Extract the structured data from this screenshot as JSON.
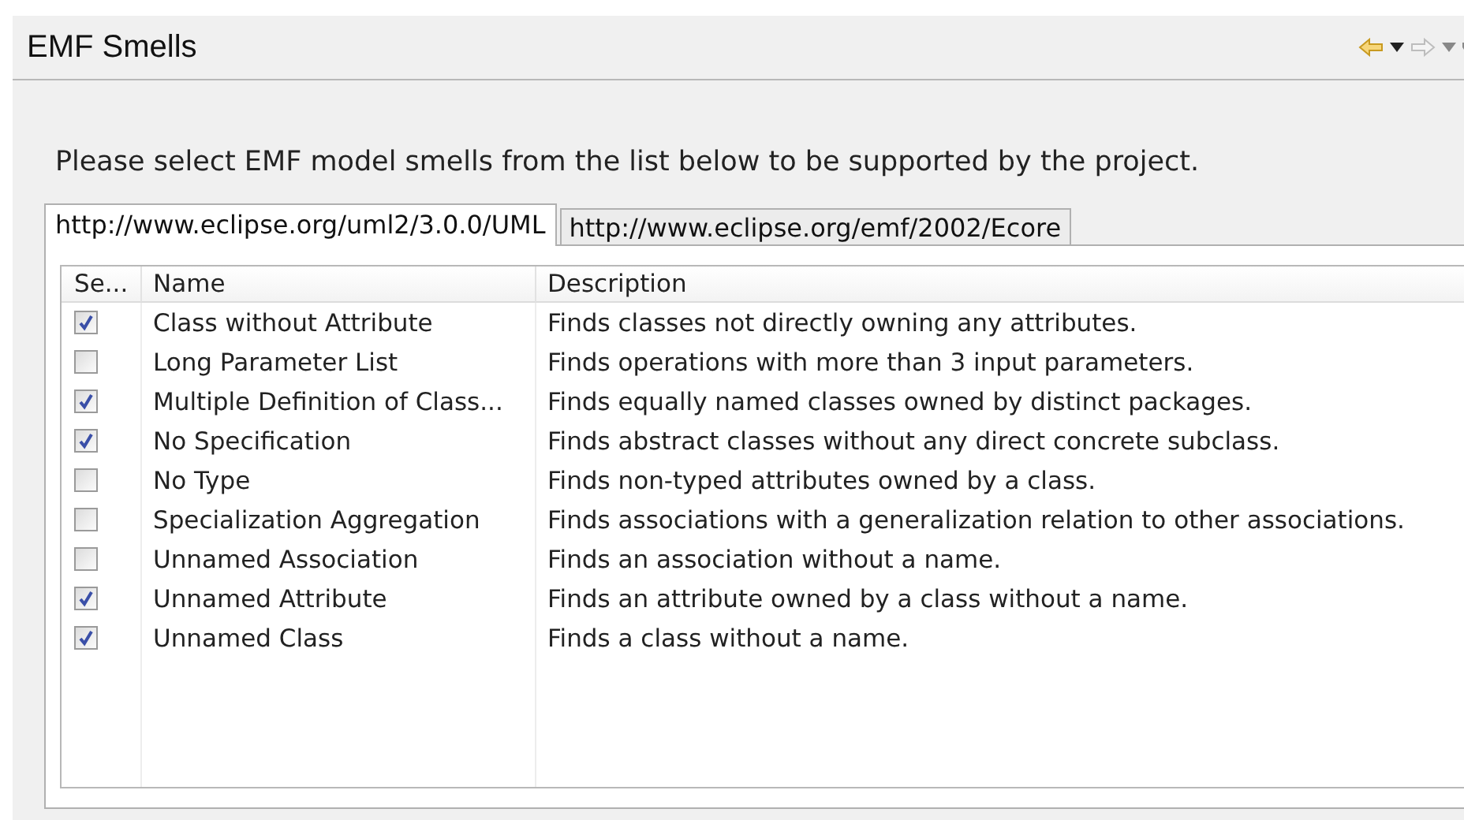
{
  "view": {
    "title": "EMF Smells",
    "back_enabled": true,
    "forward_enabled": false
  },
  "intro": "Please select EMF model smells from the list below to be supported by the project.",
  "tabs": [
    {
      "label": "http://www.eclipse.org/uml2/3.0.0/UML",
      "selected": true
    },
    {
      "label": "http://www.eclipse.org/emf/2002/Ecore",
      "selected": false
    }
  ],
  "table": {
    "columns": [
      "Se...",
      "Name",
      "Description"
    ],
    "rows": [
      {
        "checked": true,
        "name": "Class without Attribute",
        "description": "Finds classes not directly owning any attributes."
      },
      {
        "checked": false,
        "name": "Long Parameter List",
        "description": "Finds operations with more than 3 input parameters."
      },
      {
        "checked": true,
        "name": "Multiple Definition of Class...",
        "description": "Finds equally named classes owned by distinct packages."
      },
      {
        "checked": true,
        "name": "No Specification",
        "description": "Finds abstract classes without any direct concrete subclass."
      },
      {
        "checked": false,
        "name": "No Type",
        "description": "Finds non-typed attributes owned by a class."
      },
      {
        "checked": false,
        "name": "Specialization Aggregation",
        "description": "Finds associations with a generalization relation to other associations."
      },
      {
        "checked": false,
        "name": "Unnamed Association",
        "description": "Finds an association without a name."
      },
      {
        "checked": true,
        "name": "Unnamed Attribute",
        "description": "Finds an attribute owned by a class without a name."
      },
      {
        "checked": true,
        "name": "Unnamed Class",
        "description": "Finds a class without a name."
      }
    ]
  }
}
